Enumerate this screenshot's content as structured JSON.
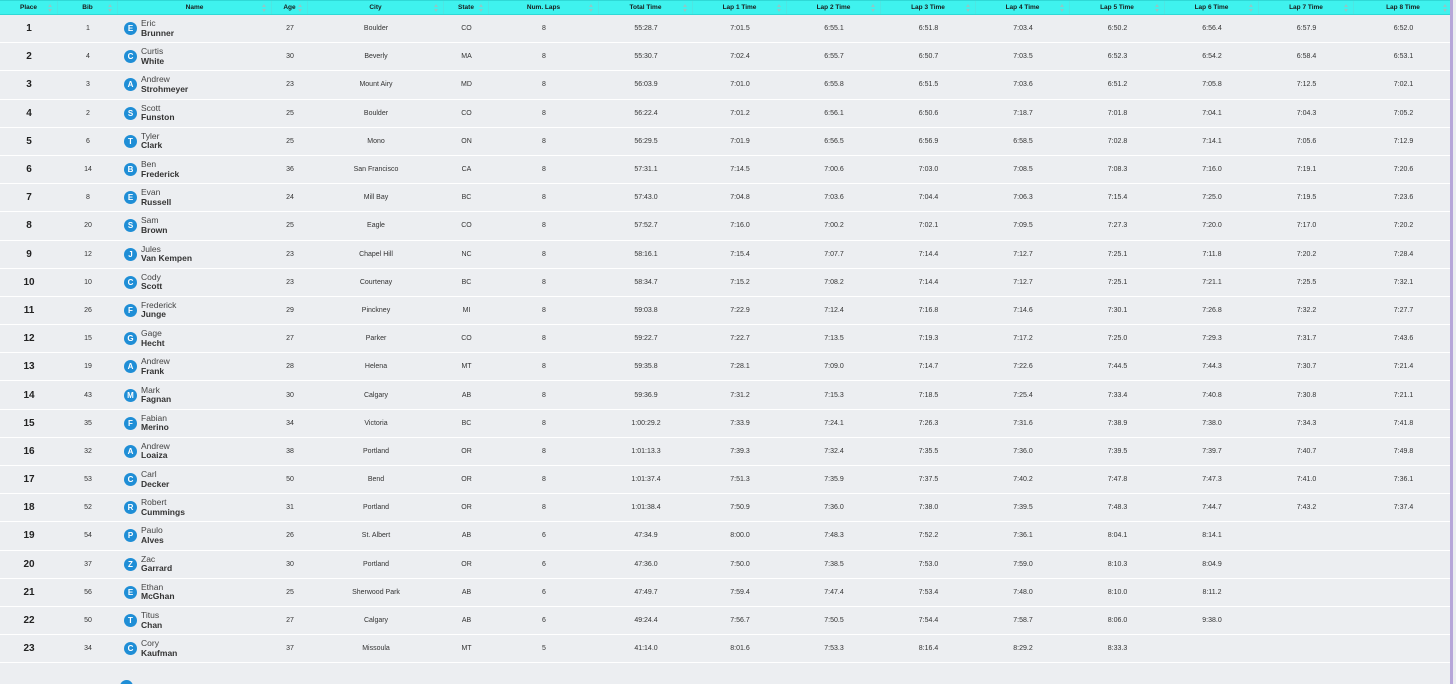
{
  "columns": [
    {
      "label": "Place",
      "w": 58
    },
    {
      "label": "Bib",
      "w": 60
    },
    {
      "label": "Name",
      "w": 154
    },
    {
      "label": "Age",
      "w": 36
    },
    {
      "label": "City",
      "w": 136
    },
    {
      "label": "State",
      "w": 45
    },
    {
      "label": "Num. Laps",
      "w": 110
    },
    {
      "label": "Total Time",
      "w": 94
    },
    {
      "label": "Lap 1 Time",
      "w": 94
    },
    {
      "label": "Lap 2 Time",
      "w": 94
    },
    {
      "label": "Lap 3 Time",
      "w": 95
    },
    {
      "label": "Lap 4 Time",
      "w": 94
    },
    {
      "label": "Lap 5 Time",
      "w": 95
    },
    {
      "label": "Lap 6 Time",
      "w": 94
    },
    {
      "label": "Lap 7 Time",
      "w": 95
    },
    {
      "label": "Lap 8 Time",
      "w": 99
    }
  ],
  "rows": [
    {
      "place": "1",
      "bib": "1",
      "initial": "E",
      "first": "Eric",
      "last": "Brunner",
      "age": "27",
      "city": "Boulder",
      "state": "CO",
      "laps": "8",
      "total": "55:28.7",
      "lap": [
        "7:01.5",
        "6:55.1",
        "6:51.8",
        "7:03.4",
        "6:50.2",
        "6:56.4",
        "6:57.9",
        "6:52.0"
      ]
    },
    {
      "place": "2",
      "bib": "4",
      "initial": "C",
      "first": "Curtis",
      "last": "White",
      "age": "30",
      "city": "Beverly",
      "state": "MA",
      "laps": "8",
      "total": "55:30.7",
      "lap": [
        "7:02.4",
        "6:55.7",
        "6:50.7",
        "7:03.5",
        "6:52.3",
        "6:54.2",
        "6:58.4",
        "6:53.1"
      ]
    },
    {
      "place": "3",
      "bib": "3",
      "initial": "A",
      "first": "Andrew",
      "last": "Strohmeyer",
      "age": "23",
      "city": "Mount Airy",
      "state": "MD",
      "laps": "8",
      "total": "56:03.9",
      "lap": [
        "7:01.0",
        "6:55.8",
        "6:51.5",
        "7:03.6",
        "6:51.2",
        "7:05.8",
        "7:12.5",
        "7:02.1"
      ]
    },
    {
      "place": "4",
      "bib": "2",
      "initial": "S",
      "first": "Scott",
      "last": "Funston",
      "age": "25",
      "city": "Boulder",
      "state": "CO",
      "laps": "8",
      "total": "56:22.4",
      "lap": [
        "7:01.2",
        "6:56.1",
        "6:50.6",
        "7:18.7",
        "7:01.8",
        "7:04.1",
        "7:04.3",
        "7:05.2"
      ]
    },
    {
      "place": "5",
      "bib": "6",
      "initial": "T",
      "first": "Tyler",
      "last": "Clark",
      "age": "25",
      "city": "Mono",
      "state": "ON",
      "laps": "8",
      "total": "56:29.5",
      "lap": [
        "7:01.9",
        "6:56.5",
        "6:56.9",
        "6:58.5",
        "7:02.8",
        "7:14.1",
        "7:05.6",
        "7:12.9"
      ]
    },
    {
      "place": "6",
      "bib": "14",
      "initial": "B",
      "first": "Ben",
      "last": "Frederick",
      "age": "36",
      "city": "San Francisco",
      "state": "CA",
      "laps": "8",
      "total": "57:31.1",
      "lap": [
        "7:14.5",
        "7:00.6",
        "7:03.0",
        "7:08.5",
        "7:08.3",
        "7:16.0",
        "7:19.1",
        "7:20.6"
      ]
    },
    {
      "place": "7",
      "bib": "8",
      "initial": "E",
      "first": "Evan",
      "last": "Russell",
      "age": "24",
      "city": "Mill Bay",
      "state": "BC",
      "laps": "8",
      "total": "57:43.0",
      "lap": [
        "7:04.8",
        "7:03.6",
        "7:04.4",
        "7:06.3",
        "7:15.4",
        "7:25.0",
        "7:19.5",
        "7:23.6"
      ]
    },
    {
      "place": "8",
      "bib": "20",
      "initial": "S",
      "first": "Sam",
      "last": "Brown",
      "age": "25",
      "city": "Eagle",
      "state": "CO",
      "laps": "8",
      "total": "57:52.7",
      "lap": [
        "7:16.0",
        "7:00.2",
        "7:02.1",
        "7:09.5",
        "7:27.3",
        "7:20.0",
        "7:17.0",
        "7:20.2"
      ]
    },
    {
      "place": "9",
      "bib": "12",
      "initial": "J",
      "first": "Jules",
      "last": "Van Kempen",
      "age": "23",
      "city": "Chapel Hill",
      "state": "NC",
      "laps": "8",
      "total": "58:16.1",
      "lap": [
        "7:15.4",
        "7:07.7",
        "7:14.4",
        "7:12.7",
        "7:25.1",
        "7:11.8",
        "7:20.2",
        "7:28.4"
      ]
    },
    {
      "place": "10",
      "bib": "10",
      "initial": "C",
      "first": "Cody",
      "last": "Scott",
      "age": "23",
      "city": "Courtenay",
      "state": "BC",
      "laps": "8",
      "total": "58:34.7",
      "lap": [
        "7:15.2",
        "7:08.2",
        "7:14.4",
        "7:12.7",
        "7:25.1",
        "7:21.1",
        "7:25.5",
        "7:32.1"
      ]
    },
    {
      "place": "11",
      "bib": "26",
      "initial": "F",
      "first": "Frederick",
      "last": "Junge",
      "age": "29",
      "city": "Pinckney",
      "state": "MI",
      "laps": "8",
      "total": "59:03.8",
      "lap": [
        "7:22.9",
        "7:12.4",
        "7:16.8",
        "7:14.6",
        "7:30.1",
        "7:26.8",
        "7:32.2",
        "7:27.7"
      ]
    },
    {
      "place": "12",
      "bib": "15",
      "initial": "G",
      "first": "Gage",
      "last": "Hecht",
      "age": "27",
      "city": "Parker",
      "state": "CO",
      "laps": "8",
      "total": "59:22.7",
      "lap": [
        "7:22.7",
        "7:13.5",
        "7:19.3",
        "7:17.2",
        "7:25.0",
        "7:29.3",
        "7:31.7",
        "7:43.6"
      ]
    },
    {
      "place": "13",
      "bib": "19",
      "initial": "A",
      "first": "Andrew",
      "last": "Frank",
      "age": "28",
      "city": "Helena",
      "state": "MT",
      "laps": "8",
      "total": "59:35.8",
      "lap": [
        "7:28.1",
        "7:09.0",
        "7:14.7",
        "7:22.6",
        "7:44.5",
        "7:44.3",
        "7:30.7",
        "7:21.4"
      ]
    },
    {
      "place": "14",
      "bib": "43",
      "initial": "M",
      "first": "Mark",
      "last": "Fagnan",
      "age": "30",
      "city": "Calgary",
      "state": "AB",
      "laps": "8",
      "total": "59:36.9",
      "lap": [
        "7:31.2",
        "7:15.3",
        "7:18.5",
        "7:25.4",
        "7:33.4",
        "7:40.8",
        "7:30.8",
        "7:21.1"
      ]
    },
    {
      "place": "15",
      "bib": "35",
      "initial": "F",
      "first": "Fabian",
      "last": "Merino",
      "age": "34",
      "city": "Victoria",
      "state": "BC",
      "laps": "8",
      "total": "1:00:29.2",
      "lap": [
        "7:33.9",
        "7:24.1",
        "7:26.3",
        "7:31.6",
        "7:38.9",
        "7:38.0",
        "7:34.3",
        "7:41.8"
      ]
    },
    {
      "place": "16",
      "bib": "32",
      "initial": "A",
      "first": "Andrew",
      "last": "Loaiza",
      "age": "38",
      "city": "Portland",
      "state": "OR",
      "laps": "8",
      "total": "1:01:13.3",
      "lap": [
        "7:39.3",
        "7:32.4",
        "7:35.5",
        "7:36.0",
        "7:39.5",
        "7:39.7",
        "7:40.7",
        "7:49.8"
      ]
    },
    {
      "place": "17",
      "bib": "53",
      "initial": "C",
      "first": "Carl",
      "last": "Decker",
      "age": "50",
      "city": "Bend",
      "state": "OR",
      "laps": "8",
      "total": "1:01:37.4",
      "lap": [
        "7:51.3",
        "7:35.9",
        "7:37.5",
        "7:40.2",
        "7:47.8",
        "7:47.3",
        "7:41.0",
        "7:36.1"
      ]
    },
    {
      "place": "18",
      "bib": "52",
      "initial": "R",
      "first": "Robert",
      "last": "Cummings",
      "age": "31",
      "city": "Portland",
      "state": "OR",
      "laps": "8",
      "total": "1:01:38.4",
      "lap": [
        "7:50.9",
        "7:36.0",
        "7:38.0",
        "7:39.5",
        "7:48.3",
        "7:44.7",
        "7:43.2",
        "7:37.4"
      ]
    },
    {
      "place": "19",
      "bib": "54",
      "initial": "P",
      "first": "Paulo",
      "last": "Alves",
      "age": "26",
      "city": "St. Albert",
      "state": "AB",
      "laps": "6",
      "total": "47:34.9",
      "lap": [
        "8:00.0",
        "7:48.3",
        "7:52.2",
        "7:36.1",
        "8:04.1",
        "8:14.1",
        "",
        ""
      ]
    },
    {
      "place": "20",
      "bib": "37",
      "initial": "Z",
      "first": "Zac",
      "last": "Garrard",
      "age": "30",
      "city": "Portland",
      "state": "OR",
      "laps": "6",
      "total": "47:36.0",
      "lap": [
        "7:50.0",
        "7:38.5",
        "7:53.0",
        "7:59.0",
        "8:10.3",
        "8:04.9",
        "",
        ""
      ]
    },
    {
      "place": "21",
      "bib": "56",
      "initial": "E",
      "first": "Ethan",
      "last": "McGhan",
      "age": "25",
      "city": "Sherwood Park",
      "state": "AB",
      "laps": "6",
      "total": "47:49.7",
      "lap": [
        "7:59.4",
        "7:47.4",
        "7:53.4",
        "7:48.0",
        "8:10.0",
        "8:11.2",
        "",
        ""
      ]
    },
    {
      "place": "22",
      "bib": "50",
      "initial": "T",
      "first": "Titus",
      "last": "Chan",
      "age": "27",
      "city": "Calgary",
      "state": "AB",
      "laps": "6",
      "total": "49:24.4",
      "lap": [
        "7:56.7",
        "7:50.5",
        "7:54.4",
        "7:58.7",
        "8:06.0",
        "9:38.0",
        "",
        ""
      ]
    },
    {
      "place": "23",
      "bib": "34",
      "initial": "C",
      "first": "Cory",
      "last": "Kaufman",
      "age": "37",
      "city": "Missoula",
      "state": "MT",
      "laps": "5",
      "total": "41:14.0",
      "lap": [
        "8:01.6",
        "7:53.3",
        "8:16.4",
        "8:29.2",
        "8:33.3",
        "",
        "",
        ""
      ]
    }
  ],
  "colors": {
    "header_bg": "#3ff2ee",
    "avatar": "#1f8ed6",
    "row_bg": "#eceef1",
    "row_divider": "#ffffff"
  }
}
